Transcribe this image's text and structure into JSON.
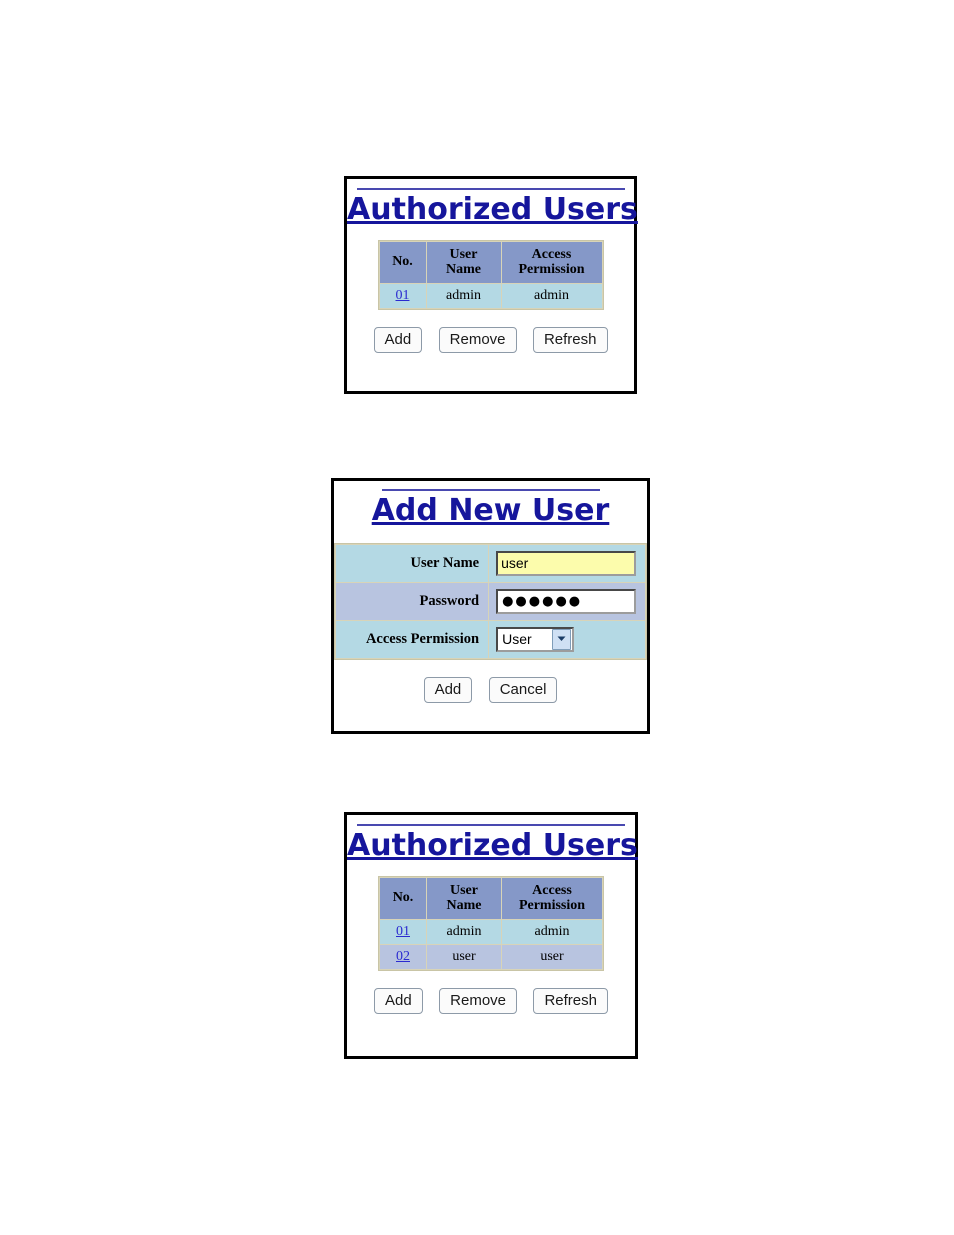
{
  "page": {
    "background": "#ffffff",
    "title_color": "#16169c",
    "link_color": "#2a2ad0",
    "header_bg": "#8598c8",
    "row_even_bg": "#b4d9e4",
    "row_odd_bg": "#b8c4e0",
    "table_border": "#d8d4b8",
    "autofill_bg": "#fcfcac"
  },
  "panels": {
    "users_before": {
      "title": "Authorized Users",
      "table": {
        "headers": [
          "No.",
          "User Name",
          "Access Permission"
        ],
        "rows": [
          {
            "no": "01",
            "user_name": "admin",
            "access_permission": "admin"
          }
        ]
      },
      "buttons": {
        "add": "Add",
        "remove": "Remove",
        "refresh": "Refresh"
      }
    },
    "add_new_user": {
      "title": "Add New User",
      "fields": {
        "user_name_label": "User Name",
        "user_name_value": "user",
        "password_label": "Password",
        "password_value": "●●●●●●",
        "access_permission_label": "Access Permission",
        "access_permission_value": "User"
      },
      "buttons": {
        "add": "Add",
        "cancel": "Cancel"
      }
    },
    "users_after": {
      "title": "Authorized Users",
      "table": {
        "headers": [
          "No.",
          "User Name",
          "Access Permission"
        ],
        "rows": [
          {
            "no": "01",
            "user_name": "admin",
            "access_permission": "admin"
          },
          {
            "no": "02",
            "user_name": "user",
            "access_permission": "user"
          }
        ]
      },
      "buttons": {
        "add": "Add",
        "remove": "Remove",
        "refresh": "Refresh"
      }
    }
  }
}
